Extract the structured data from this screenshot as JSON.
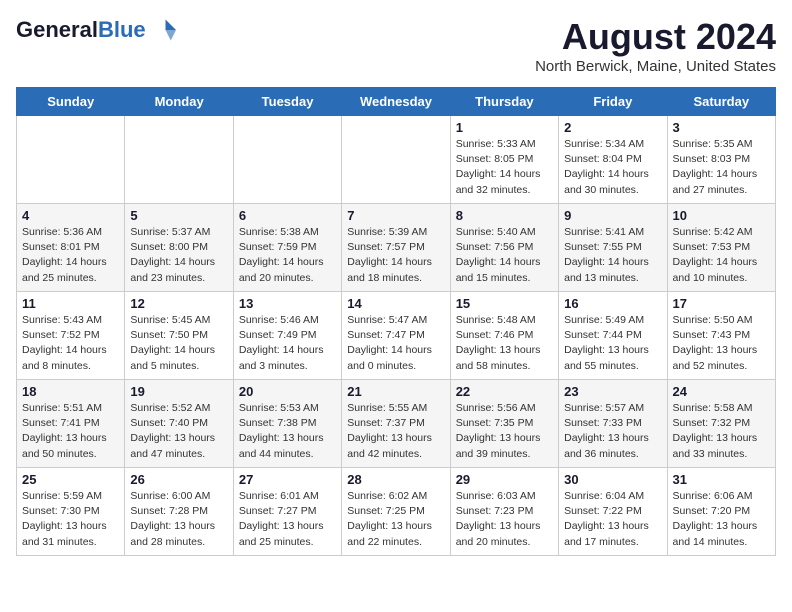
{
  "header": {
    "logo_line1": "General",
    "logo_line2": "Blue",
    "main_title": "August 2024",
    "subtitle": "North Berwick, Maine, United States"
  },
  "days_of_week": [
    "Sunday",
    "Monday",
    "Tuesday",
    "Wednesday",
    "Thursday",
    "Friday",
    "Saturday"
  ],
  "weeks": [
    [
      {
        "day": "",
        "info": ""
      },
      {
        "day": "",
        "info": ""
      },
      {
        "day": "",
        "info": ""
      },
      {
        "day": "",
        "info": ""
      },
      {
        "day": "1",
        "info": "Sunrise: 5:33 AM\nSunset: 8:05 PM\nDaylight: 14 hours\nand 32 minutes."
      },
      {
        "day": "2",
        "info": "Sunrise: 5:34 AM\nSunset: 8:04 PM\nDaylight: 14 hours\nand 30 minutes."
      },
      {
        "day": "3",
        "info": "Sunrise: 5:35 AM\nSunset: 8:03 PM\nDaylight: 14 hours\nand 27 minutes."
      }
    ],
    [
      {
        "day": "4",
        "info": "Sunrise: 5:36 AM\nSunset: 8:01 PM\nDaylight: 14 hours\nand 25 minutes."
      },
      {
        "day": "5",
        "info": "Sunrise: 5:37 AM\nSunset: 8:00 PM\nDaylight: 14 hours\nand 23 minutes."
      },
      {
        "day": "6",
        "info": "Sunrise: 5:38 AM\nSunset: 7:59 PM\nDaylight: 14 hours\nand 20 minutes."
      },
      {
        "day": "7",
        "info": "Sunrise: 5:39 AM\nSunset: 7:57 PM\nDaylight: 14 hours\nand 18 minutes."
      },
      {
        "day": "8",
        "info": "Sunrise: 5:40 AM\nSunset: 7:56 PM\nDaylight: 14 hours\nand 15 minutes."
      },
      {
        "day": "9",
        "info": "Sunrise: 5:41 AM\nSunset: 7:55 PM\nDaylight: 14 hours\nand 13 minutes."
      },
      {
        "day": "10",
        "info": "Sunrise: 5:42 AM\nSunset: 7:53 PM\nDaylight: 14 hours\nand 10 minutes."
      }
    ],
    [
      {
        "day": "11",
        "info": "Sunrise: 5:43 AM\nSunset: 7:52 PM\nDaylight: 14 hours\nand 8 minutes."
      },
      {
        "day": "12",
        "info": "Sunrise: 5:45 AM\nSunset: 7:50 PM\nDaylight: 14 hours\nand 5 minutes."
      },
      {
        "day": "13",
        "info": "Sunrise: 5:46 AM\nSunset: 7:49 PM\nDaylight: 14 hours\nand 3 minutes."
      },
      {
        "day": "14",
        "info": "Sunrise: 5:47 AM\nSunset: 7:47 PM\nDaylight: 14 hours\nand 0 minutes."
      },
      {
        "day": "15",
        "info": "Sunrise: 5:48 AM\nSunset: 7:46 PM\nDaylight: 13 hours\nand 58 minutes."
      },
      {
        "day": "16",
        "info": "Sunrise: 5:49 AM\nSunset: 7:44 PM\nDaylight: 13 hours\nand 55 minutes."
      },
      {
        "day": "17",
        "info": "Sunrise: 5:50 AM\nSunset: 7:43 PM\nDaylight: 13 hours\nand 52 minutes."
      }
    ],
    [
      {
        "day": "18",
        "info": "Sunrise: 5:51 AM\nSunset: 7:41 PM\nDaylight: 13 hours\nand 50 minutes."
      },
      {
        "day": "19",
        "info": "Sunrise: 5:52 AM\nSunset: 7:40 PM\nDaylight: 13 hours\nand 47 minutes."
      },
      {
        "day": "20",
        "info": "Sunrise: 5:53 AM\nSunset: 7:38 PM\nDaylight: 13 hours\nand 44 minutes."
      },
      {
        "day": "21",
        "info": "Sunrise: 5:55 AM\nSunset: 7:37 PM\nDaylight: 13 hours\nand 42 minutes."
      },
      {
        "day": "22",
        "info": "Sunrise: 5:56 AM\nSunset: 7:35 PM\nDaylight: 13 hours\nand 39 minutes."
      },
      {
        "day": "23",
        "info": "Sunrise: 5:57 AM\nSunset: 7:33 PM\nDaylight: 13 hours\nand 36 minutes."
      },
      {
        "day": "24",
        "info": "Sunrise: 5:58 AM\nSunset: 7:32 PM\nDaylight: 13 hours\nand 33 minutes."
      }
    ],
    [
      {
        "day": "25",
        "info": "Sunrise: 5:59 AM\nSunset: 7:30 PM\nDaylight: 13 hours\nand 31 minutes."
      },
      {
        "day": "26",
        "info": "Sunrise: 6:00 AM\nSunset: 7:28 PM\nDaylight: 13 hours\nand 28 minutes."
      },
      {
        "day": "27",
        "info": "Sunrise: 6:01 AM\nSunset: 7:27 PM\nDaylight: 13 hours\nand 25 minutes."
      },
      {
        "day": "28",
        "info": "Sunrise: 6:02 AM\nSunset: 7:25 PM\nDaylight: 13 hours\nand 22 minutes."
      },
      {
        "day": "29",
        "info": "Sunrise: 6:03 AM\nSunset: 7:23 PM\nDaylight: 13 hours\nand 20 minutes."
      },
      {
        "day": "30",
        "info": "Sunrise: 6:04 AM\nSunset: 7:22 PM\nDaylight: 13 hours\nand 17 minutes."
      },
      {
        "day": "31",
        "info": "Sunrise: 6:06 AM\nSunset: 7:20 PM\nDaylight: 13 hours\nand 14 minutes."
      }
    ]
  ]
}
